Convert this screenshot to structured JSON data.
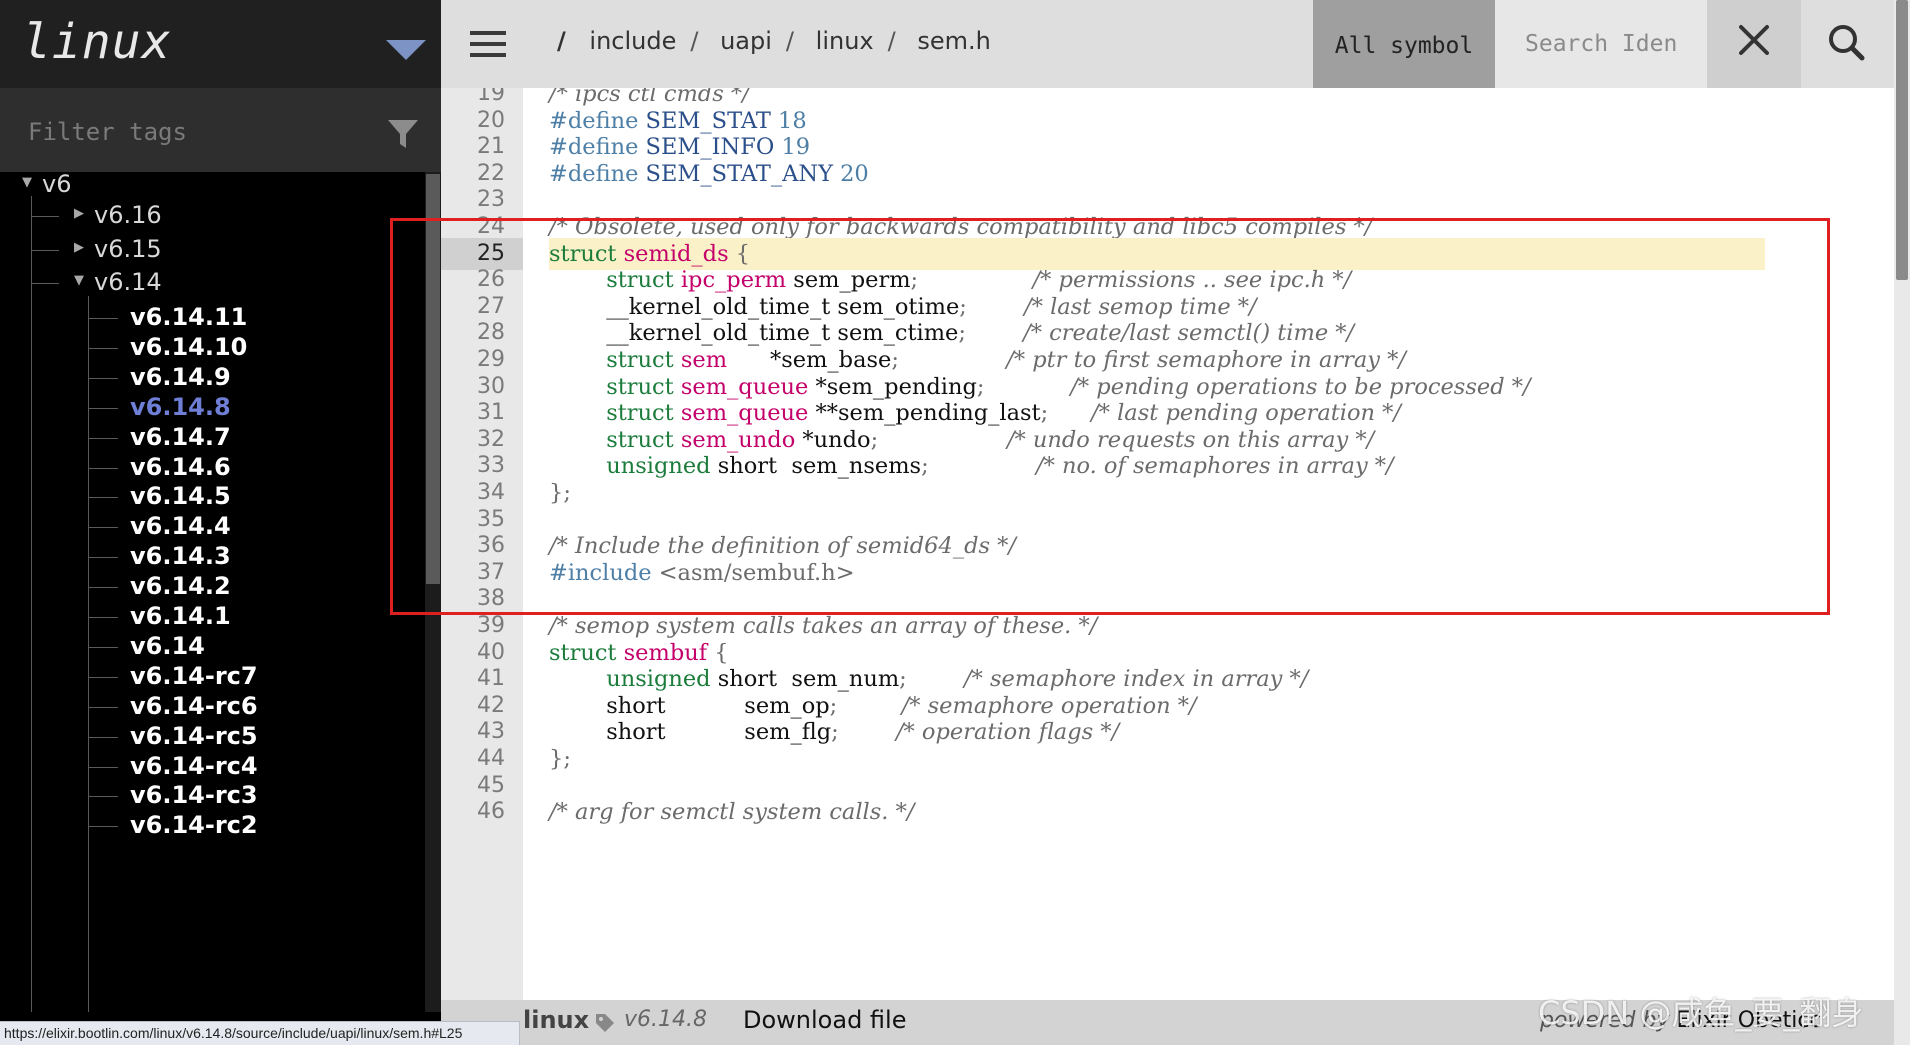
{
  "sidebar": {
    "brand": "linux",
    "filter_placeholder": "Filter tags",
    "tree": {
      "root": "v6",
      "groups": [
        "v6.16",
        "v6.15",
        "v6.14"
      ],
      "leaves": [
        "v6.14.11",
        "v6.14.10",
        "v6.14.9",
        "v6.14.8",
        "v6.14.7",
        "v6.14.6",
        "v6.14.5",
        "v6.14.4",
        "v6.14.3",
        "v6.14.2",
        "v6.14.1",
        "v6.14",
        "v6.14-rc7",
        "v6.14-rc6",
        "v6.14-rc5",
        "v6.14-rc4",
        "v6.14-rc3",
        "v6.14-rc2"
      ],
      "current": "v6.14.8"
    }
  },
  "status_url": "https://elixir.bootlin.com/linux/v6.14.8/source/include/uapi/linux/sem.h#L25",
  "header": {
    "root_slash": "/",
    "breadcrumbs": [
      "include",
      "uapi",
      "linux",
      "sem.h"
    ],
    "symbol_tab": "All symbol",
    "search_placeholder": "Search Iden"
  },
  "code": {
    "highlight_line": "25",
    "lines": [
      {
        "n": "19",
        "t": [
          [
            "cm",
            "/* ipcs ctl cmds */"
          ]
        ]
      },
      {
        "n": "20",
        "t": [
          [
            "pp",
            "#define "
          ],
          [
            "mac",
            "SEM_STAT"
          ],
          [
            "num",
            " 18"
          ]
        ]
      },
      {
        "n": "21",
        "t": [
          [
            "pp",
            "#define "
          ],
          [
            "mac",
            "SEM_INFO"
          ],
          [
            "num",
            " 19"
          ]
        ]
      },
      {
        "n": "22",
        "t": [
          [
            "pp",
            "#define "
          ],
          [
            "mac",
            "SEM_STAT_ANY"
          ],
          [
            "num",
            " 20"
          ]
        ]
      },
      {
        "n": "23",
        "t": []
      },
      {
        "n": "24",
        "t": [
          [
            "cm",
            "/* Obsolete, used only for backwards compatibility and libc5 compiles */"
          ]
        ]
      },
      {
        "n": "25",
        "t": [
          [
            "kw",
            "struct "
          ],
          [
            "id",
            "semid_ds"
          ],
          [
            "pn",
            " {"
          ]
        ]
      },
      {
        "n": "26",
        "t": [
          [
            "tx",
            "        "
          ],
          [
            "kw",
            "struct "
          ],
          [
            "id",
            "ipc_perm"
          ],
          [
            "tx",
            " sem_perm"
          ],
          [
            "pn",
            ";"
          ],
          [
            "tx",
            "                "
          ],
          [
            "cm",
            "/* permissions .. see ipc.h */"
          ]
        ]
      },
      {
        "n": "27",
        "t": [
          [
            "tx",
            "        __kernel_old_time_t sem_otime"
          ],
          [
            "pn",
            ";"
          ],
          [
            "tx",
            "        "
          ],
          [
            "cm",
            "/* last semop time */"
          ]
        ]
      },
      {
        "n": "28",
        "t": [
          [
            "tx",
            "        __kernel_old_time_t sem_ctime"
          ],
          [
            "pn",
            ";"
          ],
          [
            "tx",
            "        "
          ],
          [
            "cm",
            "/* create/last semctl() time */"
          ]
        ]
      },
      {
        "n": "29",
        "t": [
          [
            "tx",
            "        "
          ],
          [
            "kw",
            "struct "
          ],
          [
            "id",
            "sem"
          ],
          [
            "tx",
            "      *sem_base"
          ],
          [
            "pn",
            ";"
          ],
          [
            "tx",
            "               "
          ],
          [
            "cm",
            "/* ptr to first semaphore in array */"
          ]
        ]
      },
      {
        "n": "30",
        "t": [
          [
            "tx",
            "        "
          ],
          [
            "kw",
            "struct "
          ],
          [
            "id",
            "sem_queue"
          ],
          [
            "tx",
            " *sem_pending"
          ],
          [
            "pn",
            ";"
          ],
          [
            "tx",
            "            "
          ],
          [
            "cm",
            "/* pending operations to be processed */"
          ]
        ]
      },
      {
        "n": "31",
        "t": [
          [
            "tx",
            "        "
          ],
          [
            "kw",
            "struct "
          ],
          [
            "id",
            "sem_queue"
          ],
          [
            "tx",
            " **sem_pending_last"
          ],
          [
            "pn",
            ";"
          ],
          [
            "tx",
            "      "
          ],
          [
            "cm",
            "/* last pending operation */"
          ]
        ]
      },
      {
        "n": "32",
        "t": [
          [
            "tx",
            "        "
          ],
          [
            "kw",
            "struct "
          ],
          [
            "id",
            "sem_undo"
          ],
          [
            "tx",
            " *undo"
          ],
          [
            "pn",
            ";"
          ],
          [
            "tx",
            "                  "
          ],
          [
            "cm",
            "/* undo requests on this array */"
          ]
        ]
      },
      {
        "n": "33",
        "t": [
          [
            "tx",
            "        "
          ],
          [
            "kw",
            "unsigned"
          ],
          [
            "tx",
            " short  sem_nsems"
          ],
          [
            "pn",
            ";"
          ],
          [
            "tx",
            "               "
          ],
          [
            "cm",
            "/* no. of semaphores in array */"
          ]
        ]
      },
      {
        "n": "34",
        "t": [
          [
            "pn",
            "};"
          ]
        ]
      },
      {
        "n": "35",
        "t": []
      },
      {
        "n": "36",
        "t": [
          [
            "cm",
            "/* Include the definition of semid64_ds */"
          ]
        ]
      },
      {
        "n": "37",
        "t": [
          [
            "pp",
            "#include "
          ],
          [
            "pn",
            "<asm/sembuf.h>"
          ]
        ]
      },
      {
        "n": "38",
        "t": []
      },
      {
        "n": "39",
        "t": [
          [
            "cm",
            "/* semop system calls takes an array of these. */"
          ]
        ]
      },
      {
        "n": "40",
        "t": [
          [
            "kw",
            "struct "
          ],
          [
            "id",
            "sembuf"
          ],
          [
            "pn",
            " {"
          ]
        ]
      },
      {
        "n": "41",
        "t": [
          [
            "tx",
            "        "
          ],
          [
            "kw",
            "unsigned"
          ],
          [
            "tx",
            " short  sem_num"
          ],
          [
            "pn",
            ";"
          ],
          [
            "tx",
            "        "
          ],
          [
            "cm",
            "/* semaphore index in array */"
          ]
        ]
      },
      {
        "n": "42",
        "t": [
          [
            "tx",
            "        short           sem_op"
          ],
          [
            "pn",
            ";"
          ],
          [
            "tx",
            "         "
          ],
          [
            "cm",
            "/* semaphore operation */"
          ]
        ]
      },
      {
        "n": "43",
        "t": [
          [
            "tx",
            "        short           sem_flg"
          ],
          [
            "pn",
            ";"
          ],
          [
            "tx",
            "        "
          ],
          [
            "cm",
            "/* operation flags */"
          ]
        ]
      },
      {
        "n": "44",
        "t": [
          [
            "pn",
            "};"
          ]
        ]
      },
      {
        "n": "45",
        "t": []
      },
      {
        "n": "46",
        "t": [
          [
            "cm",
            "/* arg for semctl system calls. */"
          ]
        ]
      }
    ]
  },
  "footer": {
    "brand": "linux",
    "version": "v6.14.8",
    "download": "Download file",
    "powered_prefix": "powered by ",
    "powered_name": "Elixir ",
    "powered_more": "Obeticc"
  },
  "watermark": "CSDN @咸鱼_要_翻身",
  "colors": {
    "accent": "#7d93c6",
    "current_tag": "#6f7fd6",
    "highlight": "#fbf1c8",
    "annotation": "#e02020"
  }
}
